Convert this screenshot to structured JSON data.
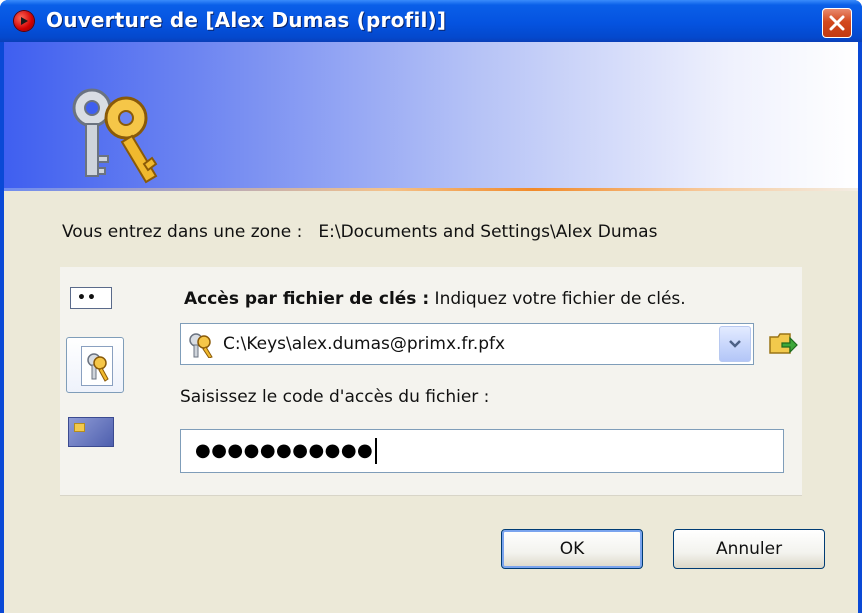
{
  "window": {
    "title": "Ouverture de [Alex Dumas (profil)]",
    "icons": {
      "title": "red-circle-arrow-icon",
      "close": "close-x-icon",
      "banner": "keys-icon"
    }
  },
  "zone": {
    "label": "Vous entrez dans une zone :",
    "path": "E:\\Documents and Settings\\Alex Dumas"
  },
  "access": {
    "label_bold": "Accès par fichier de clés :",
    "label_rest": " Indiquez votre fichier de clés.",
    "modes": [
      {
        "name": "password",
        "icon": "password-dots-icon",
        "label": "••"
      },
      {
        "name": "key-file",
        "icon": "key-file-icon",
        "selected": true
      },
      {
        "name": "smart-card",
        "icon": "smart-card-icon"
      }
    ],
    "key_file_value": "C:\\Keys\\alex.dumas@primx.fr.pfx"
  },
  "code": {
    "label": "Saisissez le code d'accès du fichier :",
    "masked_value": "●●●●●●●●●●●"
  },
  "buttons": {
    "ok": "OK",
    "cancel": "Annuler"
  },
  "colors": {
    "titlebar": "#0553e0",
    "dialog_bg": "#ece9d8",
    "close_button": "#d3491e",
    "banner_accent": "#f18a2a"
  }
}
